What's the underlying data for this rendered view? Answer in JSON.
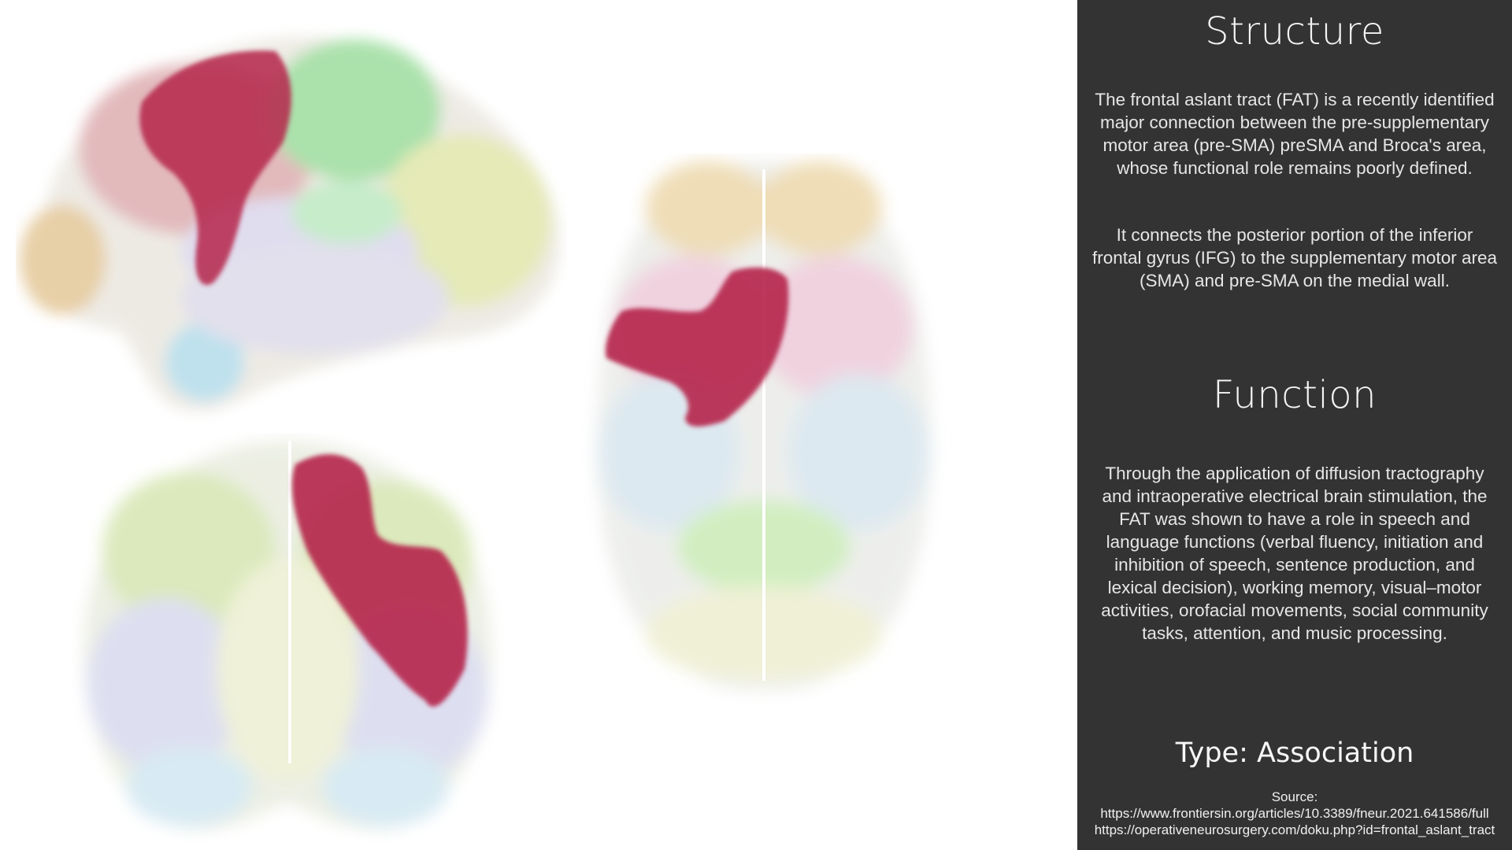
{
  "structure": {
    "heading": "Structure",
    "paragraphs": [
      "The frontal aslant tract (FAT) is a recently identified major connection between the pre-supplementary motor area (pre-SMA) preSMA and Broca's area, whose functional role remains poorly defined.",
      "It connects the posterior portion of the inferior frontal gyrus (IFG) to the supplementary motor area (SMA) and pre-SMA on the medial wall."
    ]
  },
  "function": {
    "heading": "Function",
    "paragraph": "Through the application of diffusion tractography and intraoperative electrical brain stimulation, the FAT was shown to have a role in speech and language functions (verbal fluency, initiation and inhibition of speech, sentence production, and lexical decision), working memory, visual–motor activities, orofacial movements, social community tasks, attention, and music processing."
  },
  "type_label": "Type: Association",
  "source": {
    "label": "Source:",
    "links": [
      "https://www.frontiersin.org/articles/10.3389/fneur.2021.641586/full",
      "https://operativeneurosurgery.com/doku.php?id=frontal_aslant_tract"
    ]
  },
  "colors": {
    "panel_background": "#333333",
    "tract": "#b5264a",
    "viewer_background": "#ffffff"
  }
}
